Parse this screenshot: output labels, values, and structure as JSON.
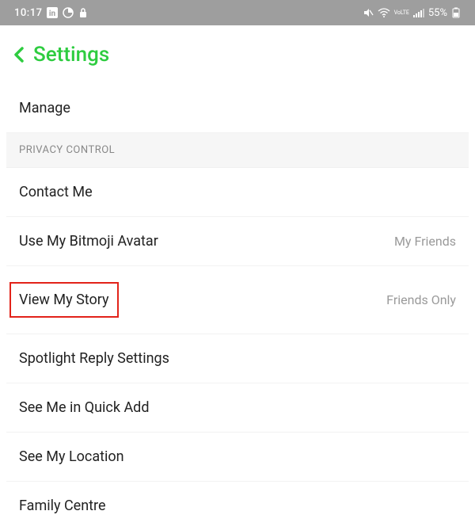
{
  "status": {
    "time": "10:17",
    "battery": "55%",
    "icons": {
      "linkedin": "in",
      "circle": "◔",
      "lock": "🔒",
      "mute": "🔇",
      "wifi": "wifi",
      "lte": "LTE",
      "signal": "▮",
      "charge": "⚡"
    }
  },
  "header": {
    "title": "Settings"
  },
  "rows": {
    "manage": {
      "label": "Manage"
    },
    "section_privacy": {
      "label": "PRIVACY CONTROL"
    },
    "contact_me": {
      "label": "Contact Me"
    },
    "use_bitmoji": {
      "label": "Use My Bitmoji Avatar",
      "value": "My Friends"
    },
    "view_story": {
      "label": "View My Story",
      "value": "Friends Only"
    },
    "spotlight": {
      "label": "Spotlight Reply Settings"
    },
    "quick_add": {
      "label": "See Me in Quick Add"
    },
    "location": {
      "label": "See My Location"
    },
    "family": {
      "label": "Family Centre"
    }
  }
}
